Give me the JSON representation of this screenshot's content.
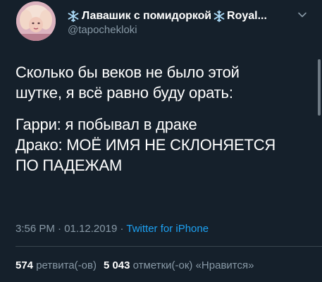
{
  "tweet": {
    "display_name_main": "Лавашик с помидоркой",
    "display_name_tail": "Royal...",
    "handle": "@tapochekloki",
    "body": {
      "paragraph1": "Сколько бы веков не было этой\nшутке, я всё равно буду орать:",
      "paragraph2": "Гарри: я побывал в драке\nДрако: МОЁ ИМЯ НЕ СКЛОНЯЕТСЯ\nПО ПАДЕЖАМ"
    },
    "meta": {
      "time": "3:56 PM",
      "separator": " · ",
      "date": "01.12.2019",
      "separator2": " · ",
      "source": "Twitter for iPhone"
    },
    "stats": {
      "retweets_count": "574",
      "retweets_label": "ретвита(-ов)",
      "likes_count": "5 043",
      "likes_label": "отметки(-ок) «Нравится»"
    }
  },
  "icons": {
    "name_prefix": "snowflake-icon",
    "name_mid": "snowflake-icon",
    "menu": "chevron-down-icon"
  },
  "colors": {
    "background": "#15202b",
    "secondary_text": "#8899a6",
    "link": "#1da1f2",
    "snowflake": "#a9d8f5"
  }
}
